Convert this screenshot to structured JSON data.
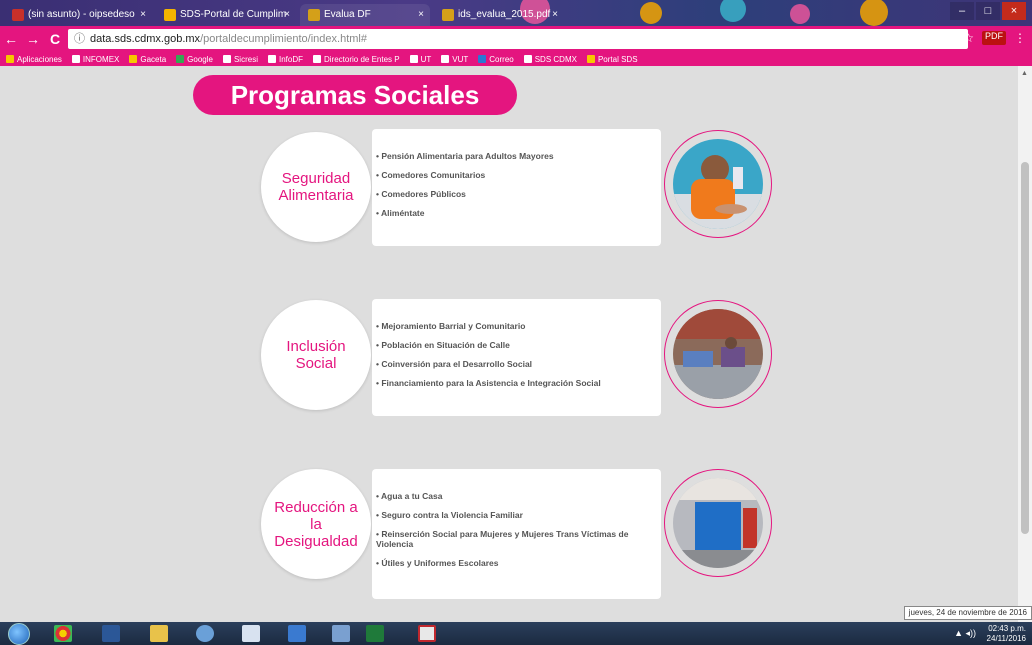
{
  "browser": {
    "tabs": [
      {
        "label": "(sin asunto) - oipsedeso",
        "favicon_color": "#c8302a",
        "active": false
      },
      {
        "label": "SDS-Portal de Cumplim",
        "favicon_color": "#f4b400",
        "active": false
      },
      {
        "label": "Evalua DF",
        "favicon_color": "#d4a019",
        "active": true
      },
      {
        "label": "ids_evalua_2015.pdf",
        "favicon_color": "#d4a019",
        "active": false
      }
    ],
    "tab_close_glyph": "×",
    "address": {
      "info_glyph": "ⓘ",
      "host": "data.sds.cdmx.gob.mx",
      "path": "/portaldecumplimiento/index.html#"
    },
    "nav": {
      "back": "←",
      "forward": "→",
      "reload": "C"
    },
    "right_icons": {
      "zoom": "⚲",
      "star": "☆",
      "pdf": "PDF",
      "menu": "⋮"
    },
    "bookmarks": [
      {
        "label": "Aplicaciones",
        "icon_color": "#f7c700"
      },
      {
        "label": "INFOMEX",
        "icon_color": "#ffffff"
      },
      {
        "label": "Gaceta",
        "icon_color": "#f7c700"
      },
      {
        "label": "Google",
        "icon_color": "#34a853"
      },
      {
        "label": "Sicresi",
        "icon_color": "#ffffff"
      },
      {
        "label": "InfoDF",
        "icon_color": "#ffffff"
      },
      {
        "label": "Directorio de Entes P",
        "icon_color": "#ffffff"
      },
      {
        "label": "UT",
        "icon_color": "#ffffff"
      },
      {
        "label": "VUT",
        "icon_color": "#ffffff"
      },
      {
        "label": "Correo",
        "icon_color": "#2b79d3"
      },
      {
        "label": "SDS CDMX",
        "icon_color": "#ffffff"
      },
      {
        "label": "Portal SDS",
        "icon_color": "#f7c700"
      }
    ]
  },
  "page": {
    "title": "Programas Sociales",
    "sections": [
      {
        "category": "Seguridad Alimentaria",
        "programs": [
          "Pensión Alimentaria para Adultos Mayores",
          "Comedores Comunitarios",
          "Comedores Públicos",
          "Aliméntate"
        ]
      },
      {
        "category": "Inclusión Social",
        "programs": [
          "Mejoramiento Barrial y Comunitario",
          "Población en Situación de Calle",
          "Coinversión para el Desarrollo Social",
          "Financiamiento para la Asistencia e Integración Social"
        ]
      },
      {
        "category": "Reducción a la Desigualdad",
        "programs": [
          "Agua a tu Casa",
          "Seguro contra la Violencia Familiar",
          "Reinserción Social para Mujeres y Mujeres Trans Víctimas de Violencia",
          "Útiles y Uniformes Escolares"
        ]
      }
    ]
  },
  "tooltip": "jueves, 24 de noviembre de 2016",
  "taskbar": {
    "clock_time": "02:43 p.m.",
    "clock_date": "24/11/2016",
    "tray_icons": "▲ ◂))"
  },
  "colors": {
    "accent": "#e4157f",
    "background": "#dedede"
  }
}
